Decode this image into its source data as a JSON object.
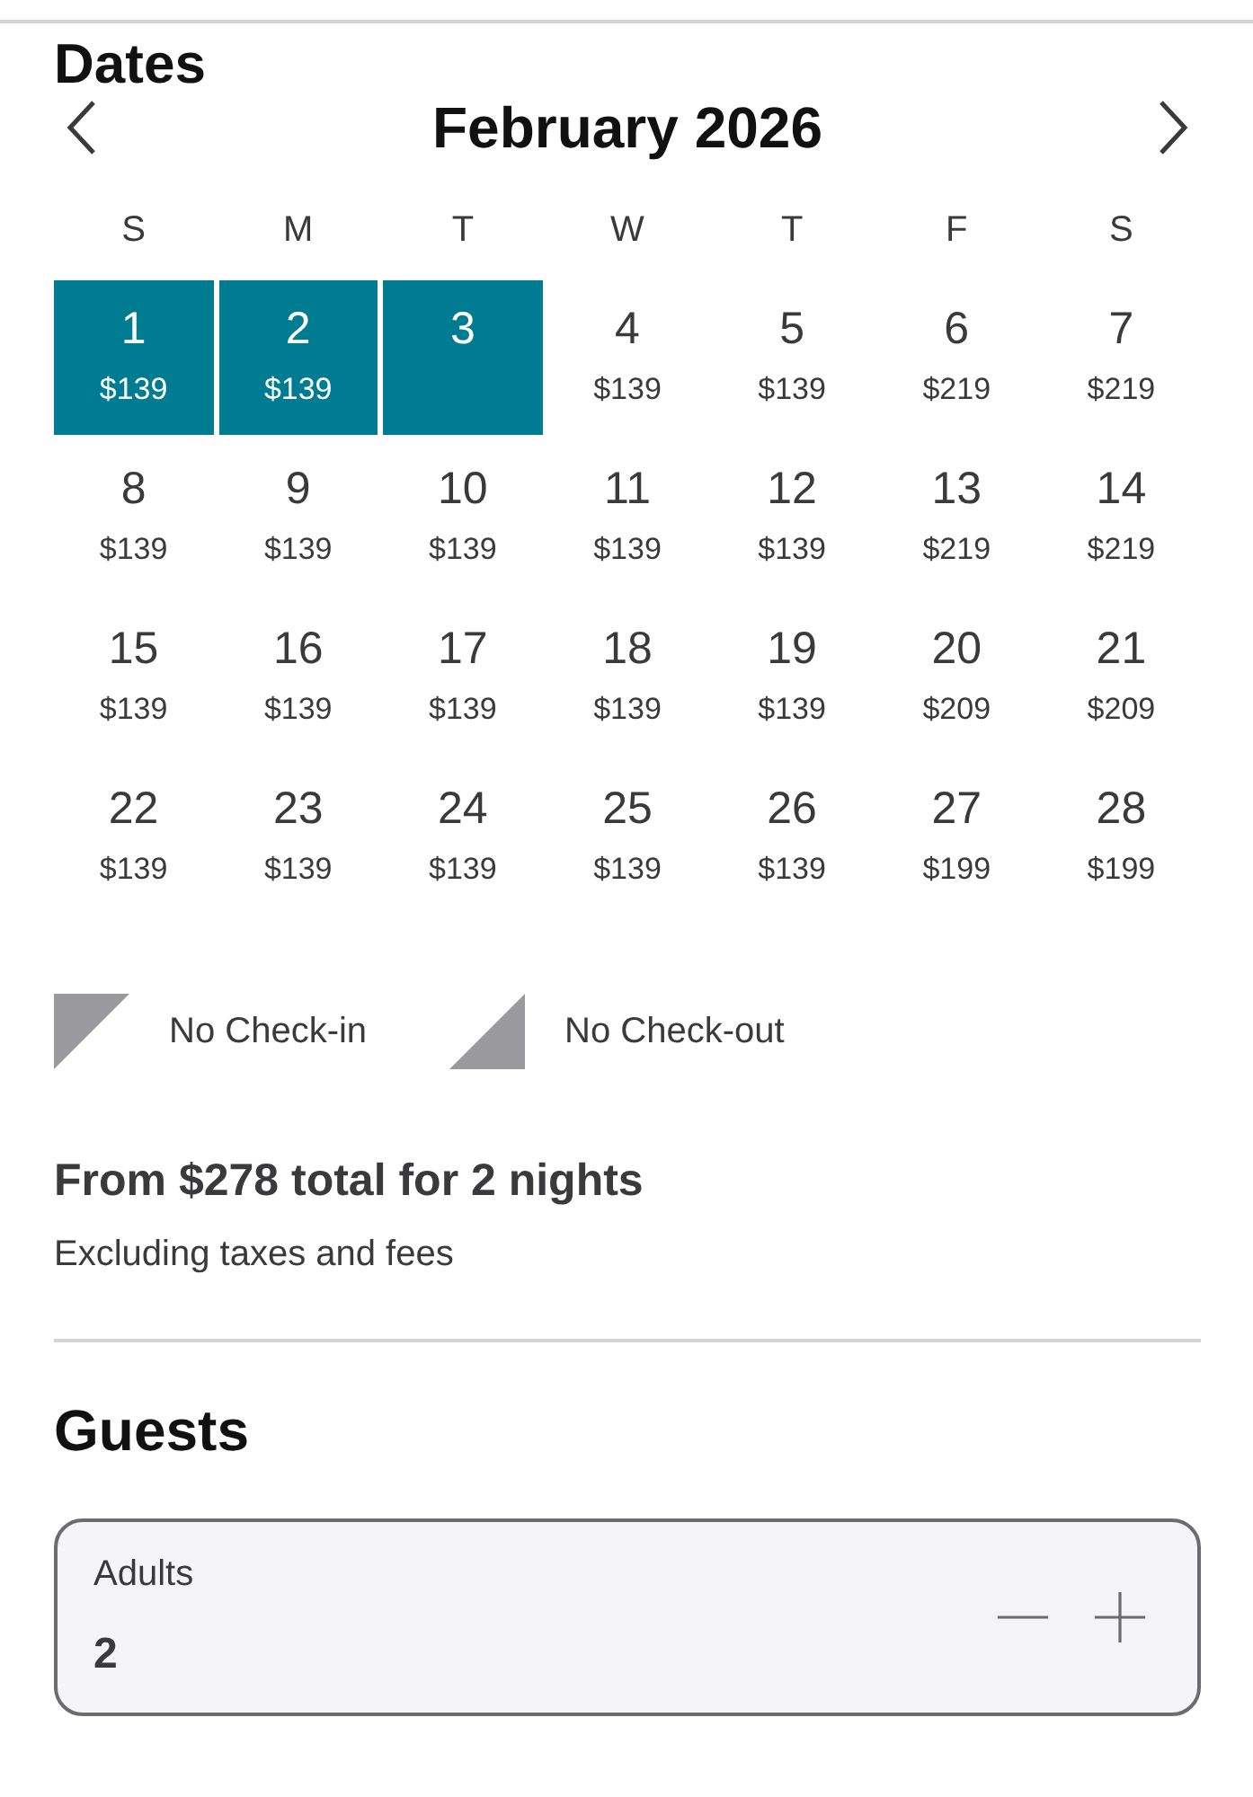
{
  "dates": {
    "heading": "Dates",
    "month": "February 2026",
    "weekdays": [
      "S",
      "M",
      "T",
      "W",
      "T",
      "F",
      "S"
    ],
    "weeks": [
      [
        {
          "day": "1",
          "price": "$139",
          "selected": true
        },
        {
          "day": "2",
          "price": "$139",
          "selected": true
        },
        {
          "day": "3",
          "selected": true
        },
        {
          "day": "4",
          "price": "$139",
          "selected": false
        },
        {
          "day": "5",
          "price": "$139",
          "selected": false
        },
        {
          "day": "6",
          "price": "$219",
          "selected": false
        },
        {
          "day": "7",
          "price": "$219",
          "selected": false
        }
      ],
      [
        {
          "day": "8",
          "price": "$139",
          "selected": false
        },
        {
          "day": "9",
          "price": "$139",
          "selected": false
        },
        {
          "day": "10",
          "price": "$139",
          "selected": false
        },
        {
          "day": "11",
          "price": "$139",
          "selected": false
        },
        {
          "day": "12",
          "price": "$139",
          "selected": false
        },
        {
          "day": "13",
          "price": "$219",
          "selected": false
        },
        {
          "day": "14",
          "price": "$219",
          "selected": false
        }
      ],
      [
        {
          "day": "15",
          "price": "$139",
          "selected": false
        },
        {
          "day": "16",
          "price": "$139",
          "selected": false
        },
        {
          "day": "17",
          "price": "$139",
          "selected": false
        },
        {
          "day": "18",
          "price": "$139",
          "selected": false
        },
        {
          "day": "19",
          "price": "$139",
          "selected": false
        },
        {
          "day": "20",
          "price": "$209",
          "selected": false
        },
        {
          "day": "21",
          "price": "$209",
          "selected": false
        }
      ],
      [
        {
          "day": "22",
          "price": "$139",
          "selected": false
        },
        {
          "day": "23",
          "price": "$139",
          "selected": false
        },
        {
          "day": "24",
          "price": "$139",
          "selected": false
        },
        {
          "day": "25",
          "price": "$139",
          "selected": false
        },
        {
          "day": "26",
          "price": "$139",
          "selected": false
        },
        {
          "day": "27",
          "price": "$199",
          "selected": false
        },
        {
          "day": "28",
          "price": "$199",
          "selected": false
        }
      ]
    ],
    "legend": [
      {
        "kind": "no-checkin",
        "label": "No Check-in"
      },
      {
        "kind": "no-checkout",
        "label": "No Check-out"
      }
    ],
    "total": "From $278 total for 2 nights",
    "note": "Excluding taxes and fees"
  },
  "guests": {
    "heading": "Guests",
    "field": {
      "label": "Adults",
      "value": "2"
    }
  }
}
